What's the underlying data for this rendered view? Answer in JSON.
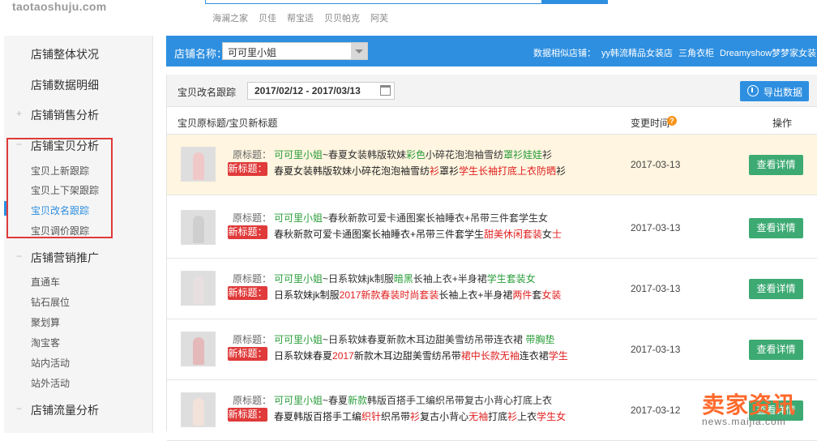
{
  "header": {
    "logo": "taotaoshuju.com",
    "hot_words": [
      "海澜之家",
      "贝佳",
      "帮宝适",
      "贝贝帕克",
      "阿芙"
    ]
  },
  "sidebar": {
    "sections": [
      {
        "label": "店铺整体状况"
      },
      {
        "label": "店铺数据明细"
      },
      {
        "label": "店铺销售分析"
      },
      {
        "label": "店铺宝贝分析"
      },
      {
        "label": "店铺营销推广"
      },
      {
        "label": "店铺流量分析"
      }
    ],
    "baobei_items": [
      "宝贝上新跟踪",
      "宝贝上下架跟踪",
      "宝贝改名跟踪",
      "宝贝调价跟踪"
    ],
    "marketing_items": [
      "直通车",
      "钻石展位",
      "聚划算",
      "淘宝客",
      "站内活动",
      "站外活动"
    ]
  },
  "shopbar": {
    "label": "店铺名称：",
    "selected_shop": "可可里小姐",
    "similar_label": "数据相似店铺：",
    "similar_shops": [
      "yy韩流精品女装店",
      "三角衣柜",
      "Dreamyshow梦梦家女装"
    ]
  },
  "panel": {
    "title": "宝贝改名跟踪",
    "date_range": "2017/02/12 - 2017/03/13",
    "export_label": "导出数据",
    "col_title": "宝贝原标题/宝贝新标题",
    "col_time": "变更时间",
    "col_action": "操作",
    "orig_label": "原标题：",
    "new_label": "新标题：",
    "detail_label": "查看详情"
  },
  "rows": [
    {
      "orig": [
        [
          "g",
          "可可里小姐"
        ],
        [
          "",
          "~春夏女装韩版软妹"
        ],
        [
          "g",
          "彩色"
        ],
        [
          "",
          "小碎花泡泡袖雪纺"
        ],
        [
          "g",
          "罩衫"
        ],
        [
          "g",
          "娃娃"
        ],
        [
          "",
          "衫"
        ]
      ],
      "new": [
        [
          "",
          "春夏女装韩版软妹小碎花泡泡袖雪纺"
        ],
        [
          "r",
          "衫"
        ],
        [
          "",
          "罩衫"
        ],
        [
          "r",
          "学生长袖打底上衣防晒"
        ],
        [
          "",
          "衫"
        ]
      ],
      "date": "2017-03-13"
    },
    {
      "orig": [
        [
          "g",
          "可可里小姐"
        ],
        [
          "",
          "~春秋新款可爱卡通图案长袖睡衣+吊带三件套学生女"
        ]
      ],
      "new": [
        [
          "",
          "春秋新款可爱卡通图案长袖睡衣+吊带三件套学生"
        ],
        [
          "r",
          "甜美休闲套装"
        ],
        [
          "",
          "女"
        ],
        [
          "r",
          "士"
        ]
      ],
      "date": "2017-03-13"
    },
    {
      "orig": [
        [
          "g",
          "可可里小姐"
        ],
        [
          "",
          "~日系软妹jk制服"
        ],
        [
          "g",
          "暗黑"
        ],
        [
          "",
          "长袖上衣+半身裙"
        ],
        [
          "g",
          "学生套装女"
        ]
      ],
      "new": [
        [
          "",
          "日系软妹jk制服"
        ],
        [
          "r",
          "2017新款春装时尚套装"
        ],
        [
          "",
          "长袖上衣+半身裙"
        ],
        [
          "r",
          "两件"
        ],
        [
          "",
          "套"
        ],
        [
          "r",
          "女装"
        ]
      ],
      "date": "2017-03-13"
    },
    {
      "orig": [
        [
          "g",
          "可可里小姐"
        ],
        [
          "",
          "~日系软妹春夏新款木耳边甜美雪纺吊带连衣裙  "
        ],
        [
          "g",
          "带胸垫"
        ]
      ],
      "new": [
        [
          "",
          "日系软妹春夏"
        ],
        [
          "r",
          "2017"
        ],
        [
          "",
          "新款木耳边甜美雪纺吊带"
        ],
        [
          "r",
          "裙中长款无袖"
        ],
        [
          "",
          "连衣裙"
        ],
        [
          "r",
          "学生"
        ]
      ],
      "date": "2017-03-13"
    },
    {
      "orig": [
        [
          "g",
          "可可里小姐"
        ],
        [
          "",
          "~春夏"
        ],
        [
          "g",
          "新款"
        ],
        [
          "",
          "韩版百搭手工编织吊带复古小背心打底上衣"
        ]
      ],
      "new": [
        [
          "",
          "春夏韩版百搭手工编"
        ],
        [
          "r",
          "织针"
        ],
        [
          "",
          "织吊带"
        ],
        [
          "r",
          "衫"
        ],
        [
          "",
          "复古小背心"
        ],
        [
          "r",
          "无袖"
        ],
        [
          "",
          "打底"
        ],
        [
          "r",
          "衫"
        ],
        [
          "",
          "上衣"
        ],
        [
          "r",
          "学生女"
        ]
      ],
      "date": "2017-03-12"
    }
  ],
  "watermark": {
    "big": "卖家资讯",
    "small": "news.maijia.com"
  },
  "colors": {
    "primary": "#2e8fe0",
    "highlight_row": "#fff5e0",
    "new_badge": "#e03a3a",
    "detail_button": "#3daa73",
    "green_text": "#2a9d3a",
    "red_text": "#e02020"
  }
}
